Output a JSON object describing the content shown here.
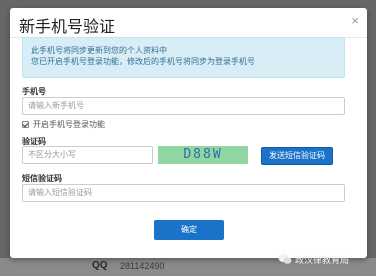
{
  "dialog": {
    "title": "新手机号验证",
    "close": "×"
  },
  "notice": {
    "line1": "此手机号将同步更新到您的个人资料中",
    "line2": "您已开启手机号登录功能，修改后的手机号将同步为登录手机号"
  },
  "phone": {
    "label": "手机号",
    "placeholder": "请输入新手机号"
  },
  "phone_login": {
    "label": "开启手机号登录功能",
    "checked": true
  },
  "captcha": {
    "label": "验证码",
    "placeholder": "不区分大小写",
    "image_text": "D88W"
  },
  "sms": {
    "send_button": "发送短信验证码",
    "label": "短信验证码",
    "placeholder": "请输入短信验证码"
  },
  "confirm_button": "确定",
  "background": {
    "qq_text": "QQ",
    "number_text": "281142490"
  },
  "watermark": "政汉律教育局"
}
